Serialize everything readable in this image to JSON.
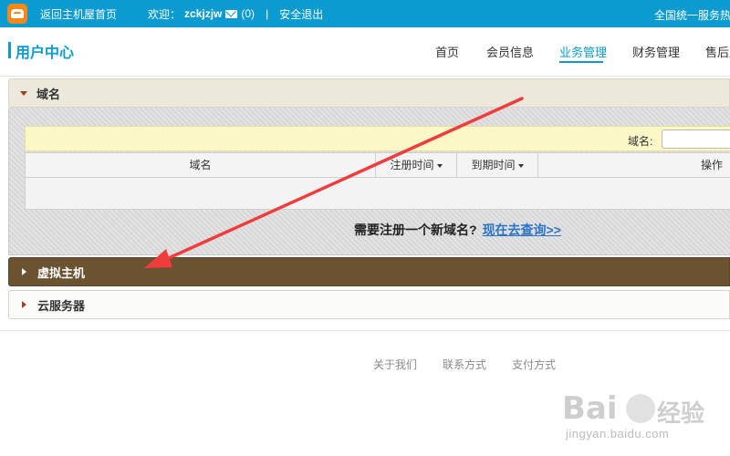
{
  "topbar": {
    "home_link": "返回主机屋首页",
    "welcome": "欢迎：",
    "username": "zckjzjw",
    "message_count": "(0)",
    "separator": "|",
    "logout": "安全退出",
    "hotline": "全国统一服务热"
  },
  "header": {
    "title": "用户中心",
    "nav": [
      {
        "label": "首页"
      },
      {
        "label": "会员信息"
      },
      {
        "label": "业务管理",
        "active": true
      },
      {
        "label": "财务管理"
      },
      {
        "label": "售后服"
      }
    ]
  },
  "sections": {
    "domain": {
      "label": "域名",
      "expanded": true
    },
    "virtual_host": {
      "label": "虚拟主机",
      "highlighted": true
    },
    "cloud_server": {
      "label": "云服务器"
    }
  },
  "domain_panel": {
    "filter_label": "域名:",
    "filter_value": "",
    "columns": [
      "域名",
      "注册时间",
      "到期时间",
      "操作"
    ],
    "rows": [],
    "register_prompt": "需要注册一个新域名?",
    "register_link": "现在去查询>>"
  },
  "footer": {
    "links": [
      "关于我们",
      "联系方式",
      "支付方式"
    ]
  },
  "watermark": {
    "brand": "Bai",
    "brand_cn": "经验",
    "url": "jingyan.baidu.com"
  },
  "colors": {
    "accent": "#0b9bd0",
    "highlight_section": "#6b5331",
    "annotation_arrow": "#f03c3c",
    "link": "#2a74c8"
  }
}
